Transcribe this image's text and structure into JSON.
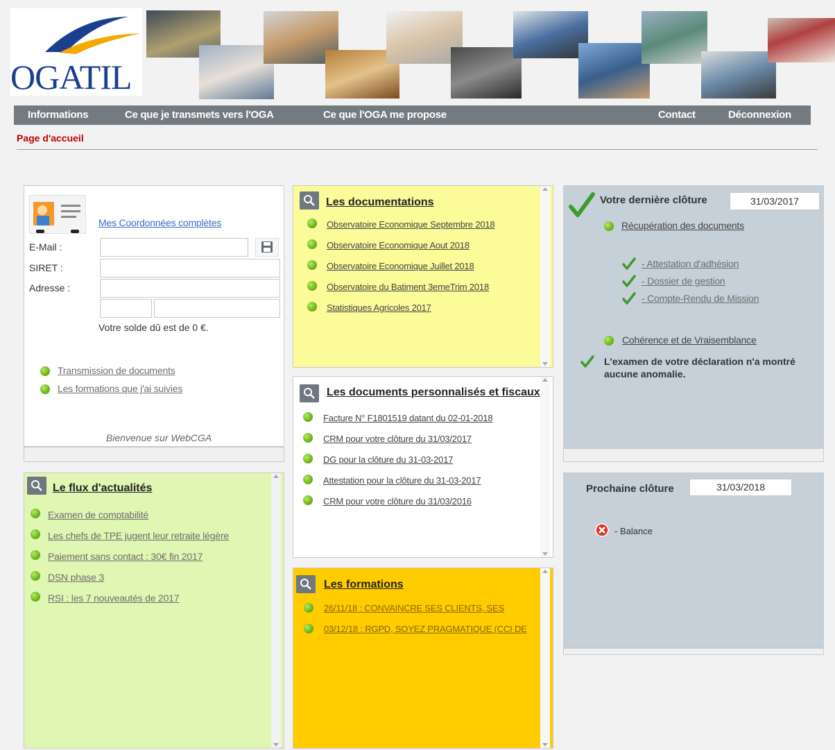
{
  "logo": {
    "text": "OGATIL"
  },
  "nav": {
    "informations": "Informations",
    "transmets": "Ce que je transmets vers l'OGA",
    "propose": "Ce que l'OGA me propose",
    "contact": "Contact",
    "deconnexion": "Déconnexion"
  },
  "breadcrumb": "Page d'accueil",
  "profile": {
    "coordonnees_link": "Mes Coordonnées complètes",
    "email_label": "E-Mail :",
    "email_value": "",
    "siret_label": "SIRET :",
    "siret_value": "",
    "adresse_label": "Adresse :",
    "adresse_value": "",
    "solde": "Votre solde dû est de 0 €.",
    "links": [
      "Transmission de documents",
      "Les formations que j'ai suivies"
    ],
    "welcome": "Bienvenue sur WebCGA"
  },
  "documentations": {
    "title": "Les documentations",
    "items": [
      "Observatoire Economique Septembre 2018",
      "Observatoire Economique Aout 2018",
      "Observatoire Economique Juillet 2018",
      "Observatoire du Batiment 3emeTrim 2018",
      "Statistiques Agricoles 2017"
    ]
  },
  "docs_perso": {
    "title": "Les documents personnalisés et fiscaux",
    "items": [
      "Facture N° F1801519 datant du 02-01-2018",
      "CRM pour votre clôture du 31/03/2017",
      "DG pour la clôture du 31-03-2017",
      "Attestation pour la clôture du 31-03-2017",
      "CRM pour votre clôture du 31/03/2016"
    ]
  },
  "formations": {
    "title": "Les formations",
    "items": [
      "26/11/18 : CONVAINCRE SES CLIENTS, SES",
      "03/12/18 : RGPD, SOYEZ PRAGMATIQUE (CCI DE"
    ]
  },
  "flux": {
    "title": "Le flux d'actualités",
    "items": [
      "Examen de comptabilité",
      "Les chefs de TPE jugent leur retraite légère",
      "Paiement sans contact : 30€ fin 2017",
      "DSN phase 3",
      "RSI : les 7 nouveautés de 2017"
    ]
  },
  "cloture": {
    "title": "Votre dernière clôture",
    "date": "31/03/2017",
    "recuperation": "Récupération des documents",
    "docs": [
      "- Attestation d'adhésion",
      "- Dossier de gestion",
      "- Compte-Rendu de Mission"
    ],
    "coherence": "Cohérence et de Vraisemblance",
    "examen": "L'examen de votre déclaration n'a montré aucune anomalie."
  },
  "prochaine": {
    "title": "Prochaine clôture",
    "date": "31/03/2018",
    "balance": "- Balance"
  },
  "colors": {
    "nav": "#737b81",
    "yellow": "#fbfb9a",
    "orange": "#ffcc00",
    "green": "#e0f6b3",
    "bluegray": "#c5d0d8",
    "crumb": "#c00000"
  }
}
